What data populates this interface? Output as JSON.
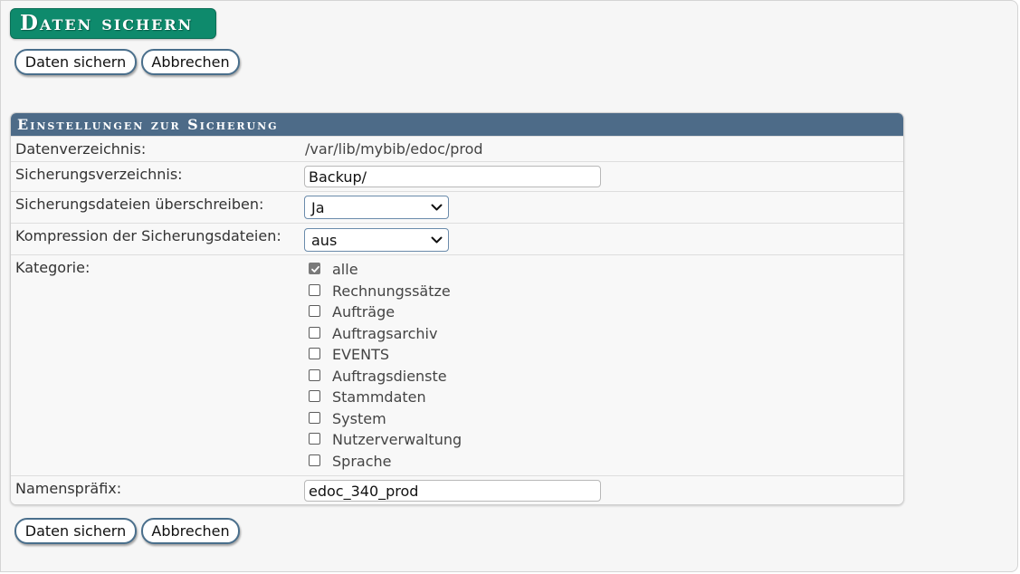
{
  "page": {
    "title": "Daten sichern"
  },
  "buttons": {
    "save_label": "Daten sichern",
    "cancel_label": "Abbrechen"
  },
  "panel": {
    "title": "Einstellungen zur Sicherung",
    "rows": {
      "data_dir": {
        "label": "Datenverzeichnis:",
        "value": "/var/lib/mybib/edoc/prod"
      },
      "backup_dir": {
        "label": "Sicherungsverzeichnis:",
        "value": "Backup/"
      },
      "overwrite": {
        "label": "Sicherungsdateien überschreiben:",
        "selected": "Ja"
      },
      "compression": {
        "label": "Kompression der Sicherungsdateien:",
        "selected": "aus"
      },
      "category": {
        "label": "Kategorie:",
        "options": [
          {
            "label": "alle",
            "checked": true
          },
          {
            "label": "Rechnungssätze",
            "checked": false
          },
          {
            "label": "Aufträge",
            "checked": false
          },
          {
            "label": "Auftragsarchiv",
            "checked": false
          },
          {
            "label": "EVENTS",
            "checked": false
          },
          {
            "label": "Auftragsdienste",
            "checked": false
          },
          {
            "label": "Stammdaten",
            "checked": false
          },
          {
            "label": "System",
            "checked": false
          },
          {
            "label": "Nutzerverwaltung",
            "checked": false
          },
          {
            "label": "Sprache",
            "checked": false
          }
        ]
      },
      "prefix": {
        "label": "Namenspräfix:",
        "value": "edoc_340_prod"
      }
    }
  },
  "colors": {
    "title_bg": "#0e8a6c",
    "panel_header_bg": "#4d6b88",
    "button_border": "#4a6f8c"
  },
  "icons": {
    "select_arrow": "chevron-down-icon",
    "checkbox_check": "check-icon"
  }
}
